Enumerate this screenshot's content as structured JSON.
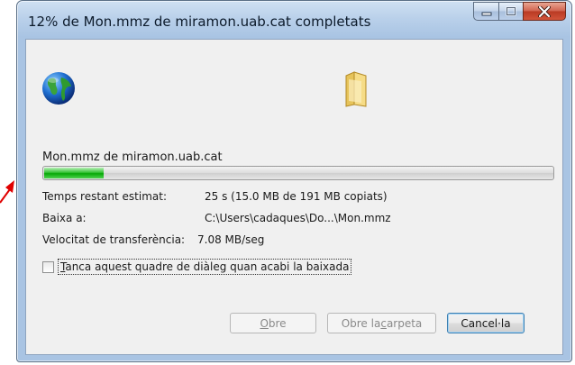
{
  "window": {
    "title": "12% de Mon.mmz de miramon.uab.cat completats"
  },
  "download": {
    "source": "Mon.mmz de miramon.uab.cat",
    "progress_percent": 12
  },
  "details": {
    "time_label": "Temps restant estimat:",
    "time_value": "25 s (15.0 MB de 191 MB copiats)",
    "dest_label": "Baixa a:",
    "dest_value": "C:\\Users\\cadaques\\Do...\\Mon.mmz",
    "speed_label": "Velocitat de transferència:",
    "speed_value": "7.08 MB/seg"
  },
  "close_checkbox": {
    "label_mnemonic": "T",
    "label_rest": "anca aquest quadre de diàleg quan acabi la baixada",
    "checked": false
  },
  "buttons": {
    "open_mnemonic": "O",
    "open_rest": "bre",
    "open_folder_pre": "Obre la ",
    "open_folder_mnemonic": "c",
    "open_folder_post": "arpeta",
    "cancel": "Cancel·la"
  },
  "icons": {
    "globe": "globe-icon",
    "folder": "folder-icon",
    "minimize": "minimize-icon",
    "maximize": "maximize-icon",
    "close": "close-icon"
  },
  "colors": {
    "progress": "#06a806",
    "close_button": "#c8452c",
    "annotation": "#e00000"
  }
}
